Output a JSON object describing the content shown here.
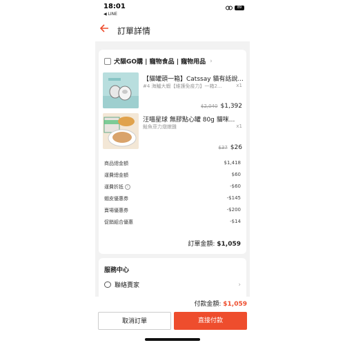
{
  "status_bar": {
    "time": "18:01",
    "back_app": "◀ LINE",
    "battery": "89"
  },
  "header": {
    "title": "訂單詳情"
  },
  "shop": {
    "name": "犬貓GO購 | 寵物食品 | 寵物用品",
    "items": [
      {
        "name": "【貓罐頭一箱】Catssay 貓有話說...",
        "variant": "#4 海鱸大蝦【維護免疫力】一箱2...",
        "qty": "x1",
        "original_price": "$2,040",
        "price": "$1,392"
      },
      {
        "name": "汪喵星球 無膠點心罐 80g 貓咪...",
        "variant": "鮭魚菲力燉嫩雞",
        "qty": "x1",
        "original_price": "$37",
        "price": "$26"
      }
    ]
  },
  "summary": [
    {
      "label": "商品總金額",
      "value": "$1,418"
    },
    {
      "label": "運費總金額",
      "value": "$60"
    },
    {
      "label": "運費折抵",
      "value": "-$60",
      "info": "i"
    },
    {
      "label": "蝦皮優惠券",
      "value": "-$145"
    },
    {
      "label": "賣場優惠券",
      "value": "-$200"
    },
    {
      "label": "促銷組合優惠",
      "value": "-$14"
    }
  ],
  "order_total": {
    "label": "訂單金額:",
    "value": "$1,059"
  },
  "service": {
    "title": "服務中心",
    "contact_label": "聯絡賣家"
  },
  "footer": {
    "pay_label": "付款金額:",
    "pay_amount": "$1,059",
    "cancel_label": "取消訂單",
    "pay_button_label": "直接付款"
  }
}
